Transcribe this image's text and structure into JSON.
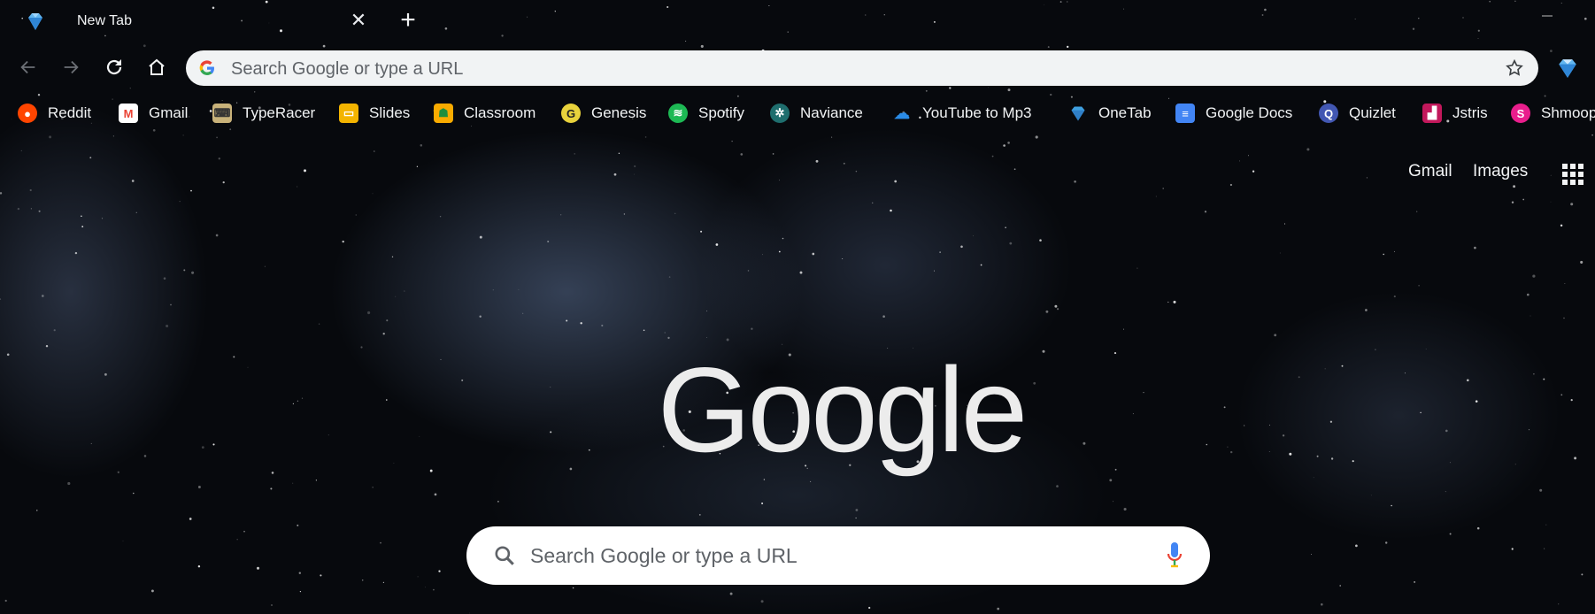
{
  "tab": {
    "title": "New Tab",
    "favicon": "onetab-diamond-icon",
    "close_glyph": "✕",
    "new_tab_glyph": "+"
  },
  "toolbar": {
    "omnibox_placeholder": "Search Google or type a URL",
    "buttons": [
      "back-icon",
      "forward-icon",
      "reload-icon",
      "home-icon"
    ]
  },
  "bookmarks": [
    {
      "label": "Reddit",
      "icon": "reddit-icon",
      "color": "#ff4500"
    },
    {
      "label": "Gmail",
      "icon": "gmail-icon",
      "color": "#ea4335"
    },
    {
      "label": "TypeRacer",
      "icon": "typeracer-icon",
      "color": "#c8b27a"
    },
    {
      "label": "Slides",
      "icon": "slides-icon",
      "color": "#f4b400"
    },
    {
      "label": "Classroom",
      "icon": "classroom-icon",
      "color": "#f9ab00"
    },
    {
      "label": "Genesis",
      "icon": "genesis-icon",
      "color": "#e8d23c"
    },
    {
      "label": "Spotify",
      "icon": "spotify-icon",
      "color": "#1db954"
    },
    {
      "label": "Naviance",
      "icon": "naviance-icon",
      "color": "#1f6e6e"
    },
    {
      "label": "YouTube to Mp3",
      "icon": "download-cloud-icon",
      "color": "#2a8be6"
    },
    {
      "label": "OneTab",
      "icon": "onetab-icon",
      "color": "#3fa0e0"
    },
    {
      "label": "Google Docs",
      "icon": "docs-icon",
      "color": "#4285f4"
    },
    {
      "label": "Quizlet",
      "icon": "quizlet-icon",
      "color": "#4257b2"
    },
    {
      "label": "Jstris",
      "icon": "jstris-icon",
      "color": "#c2185b"
    },
    {
      "label": "Shmoop",
      "icon": "shmoop-icon",
      "color": "#e91e8c"
    }
  ],
  "top_links": {
    "gmail": "Gmail",
    "images": "Images"
  },
  "logo_text": "Google",
  "search": {
    "placeholder": "Search Google or type a URL"
  }
}
